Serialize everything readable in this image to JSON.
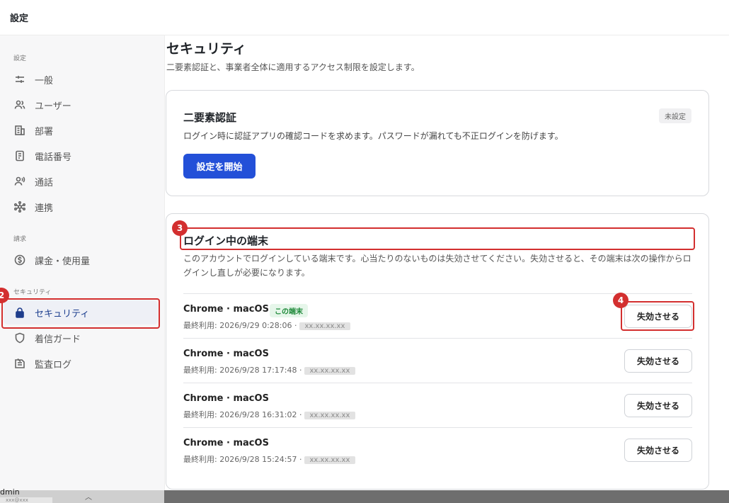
{
  "header": {
    "title": "設定"
  },
  "sidebar": {
    "sections": [
      {
        "label": "設定",
        "items": [
          {
            "label": "一般",
            "icon": "sliders-icon"
          },
          {
            "label": "ユーザー",
            "icon": "users-icon"
          },
          {
            "label": "部署",
            "icon": "building-icon"
          },
          {
            "label": "電話番号",
            "icon": "phone-list-icon"
          },
          {
            "label": "通話",
            "icon": "call-voice-icon"
          },
          {
            "label": "連携",
            "icon": "integration-icon"
          }
        ]
      },
      {
        "label": "請求",
        "items": [
          {
            "label": "課金・使用量",
            "icon": "dollar-icon"
          }
        ]
      },
      {
        "label": "セキュリティ",
        "items": [
          {
            "label": "セキュリティ",
            "icon": "lock-icon",
            "active": true
          },
          {
            "label": "着信ガード",
            "icon": "shield-icon"
          },
          {
            "label": "監査ログ",
            "icon": "audit-log-icon"
          }
        ]
      }
    ]
  },
  "user": {
    "name": "dmin",
    "email": "xxx@xxx"
  },
  "main": {
    "title": "セキュリティ",
    "subtitle": "二要素認証と、事業者全体に適用するアクセス制限を設定します。",
    "two_factor": {
      "title": "二要素認証",
      "badge": "未設定",
      "description": "ログイン時に認証アプリの確認コードを求めます。パスワードが漏れても不正ログインを防げます。",
      "button": "設定を開始"
    },
    "devices": {
      "title": "ログイン中の端末",
      "description": "このアカウントでログインしている端末です。心当たりのないものは失効させてください。失効させると、その端末は次の操作からログインし直しが必要になります。",
      "meta_prefix": "最終利用: ",
      "revoke_label": "失効させる",
      "current_badge": "この端末",
      "items": [
        {
          "name": "Chrome · macOS",
          "last_used": "2026/9/29 0:28:06",
          "ip": "xx.xx.xx.xx",
          "current": true
        },
        {
          "name": "Chrome · macOS",
          "last_used": "2026/9/28 17:17:48",
          "ip": "xx.xx.xx.xx"
        },
        {
          "name": "Chrome · macOS",
          "last_used": "2026/9/28 16:31:02",
          "ip": "xx.xx.xx.xx"
        },
        {
          "name": "Chrome · macOS",
          "last_used": "2026/9/28 15:24:57",
          "ip": "xx.xx.xx.xx"
        }
      ]
    }
  },
  "annotations": {
    "m2": "2",
    "m3": "3",
    "m4": "4"
  },
  "colors": {
    "accent": "#2350d8",
    "highlight": "#d32f2f",
    "success": "#1f8a3a"
  }
}
